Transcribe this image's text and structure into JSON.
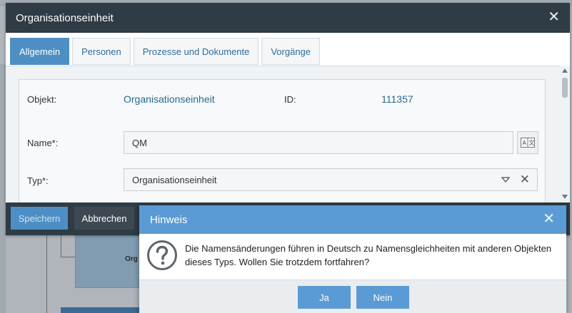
{
  "dialog": {
    "title": "Organisationseinheit",
    "tabs": [
      {
        "label": "Allgemein"
      },
      {
        "label": "Personen"
      },
      {
        "label": "Prozesse und Dokumente"
      },
      {
        "label": "Vorgänge"
      }
    ],
    "active_tab": "Allgemein",
    "fields": {
      "objekt_label": "Objekt:",
      "objekt_value": "Organisationseinheit",
      "id_label": "ID:",
      "id_value": "111357",
      "name_label": "Name*:",
      "name_value": "QM",
      "typ_label": "Typ*:",
      "typ_value": "Organisationseinheit"
    },
    "footer": {
      "save_label": "Speichern",
      "cancel_label": "Abbrechen"
    }
  },
  "background": {
    "node_label": "Org"
  },
  "modal": {
    "title": "Hinweis",
    "message": "Die Namensänderungen führen in Deutsch zu Namensgleichheiten mit anderen Objekten dieses Typs. Wollen Sie trotzdem fortfahren?",
    "yes_label": "Ja",
    "no_label": "Nein"
  },
  "colors": {
    "header_dark": "#2f3b45",
    "accent_blue": "#4d8fc4",
    "modal_blue": "#5b9bd5",
    "link_teal": "#2a6a8a"
  }
}
